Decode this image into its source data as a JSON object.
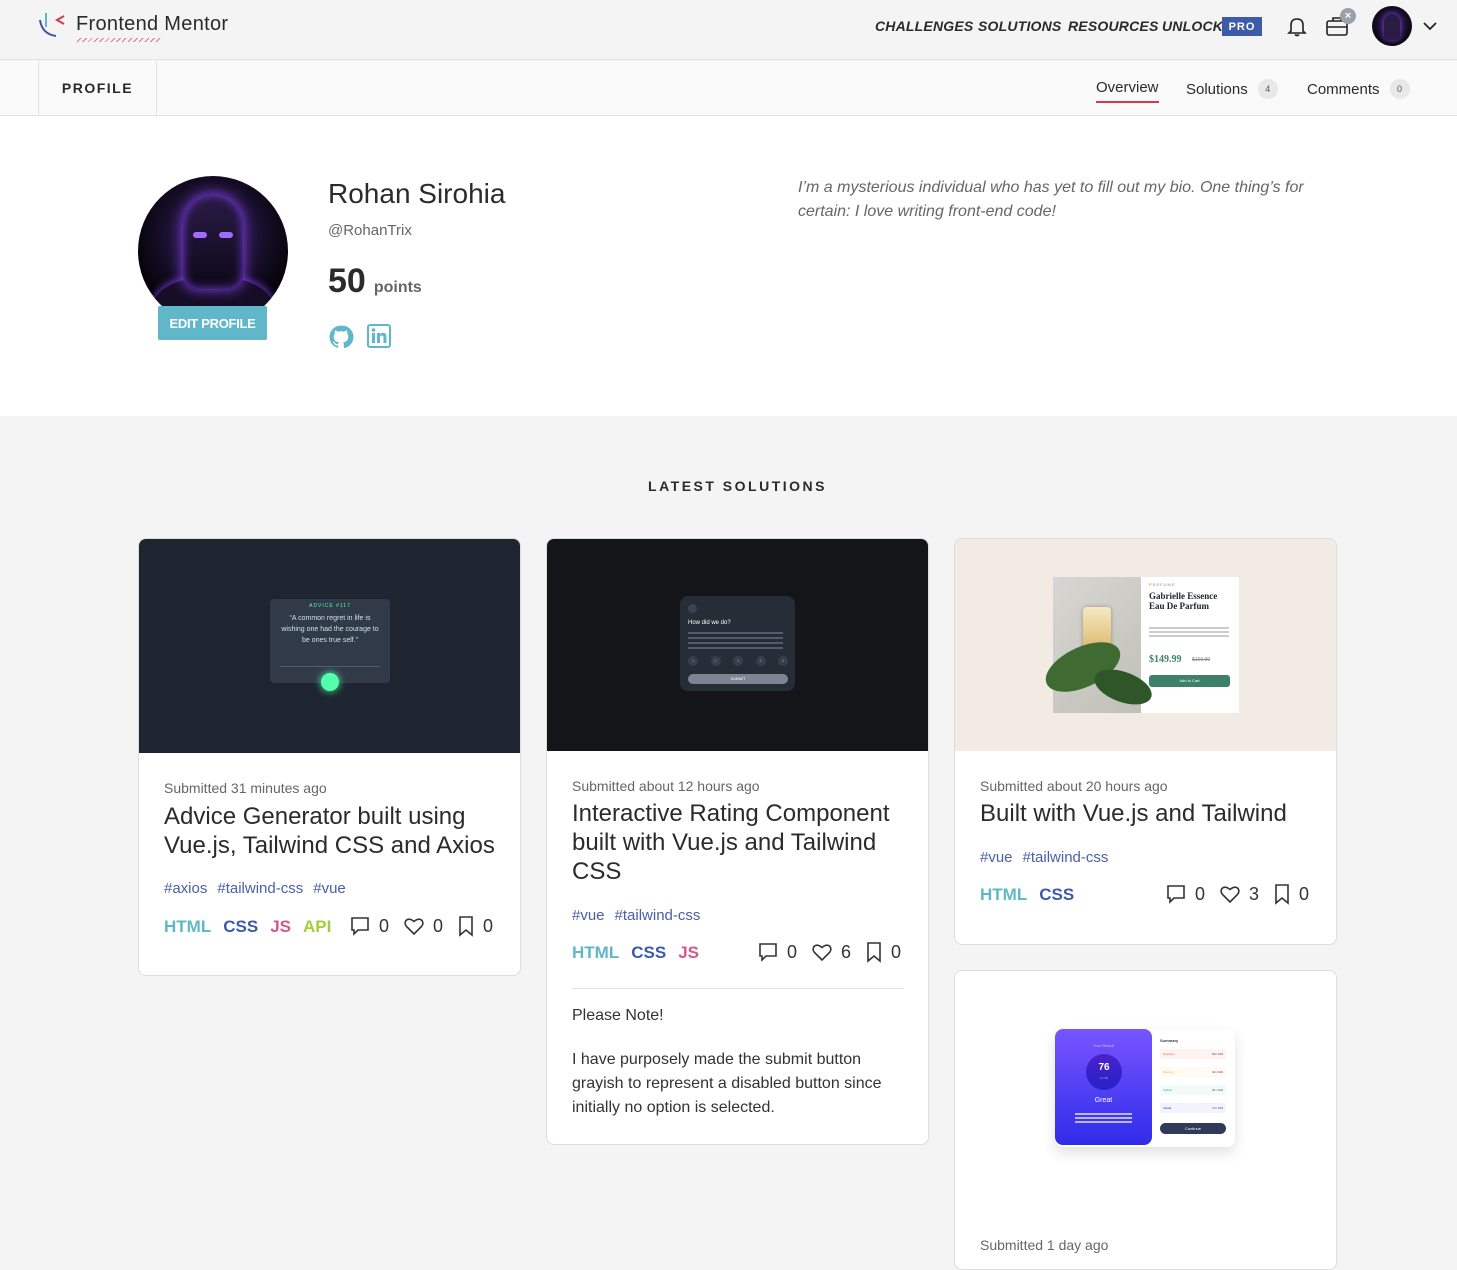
{
  "header": {
    "logo_text": "Frontend Mentor",
    "nav": [
      "CHALLENGES",
      "SOLUTIONS",
      "RESOURCES",
      "UNLOCK"
    ],
    "pro_badge": "PRO",
    "notifications_icon": "bell-icon",
    "toolbox_icon": "briefcase-icon",
    "close_badge": "×",
    "user_menu_icon": "chevron-down-icon"
  },
  "subnav": {
    "section": "PROFILE",
    "tabs": [
      {
        "label": "Overview",
        "count": ""
      },
      {
        "label": "Solutions",
        "count": "4"
      },
      {
        "label": "Comments",
        "count": "0"
      }
    ]
  },
  "profile": {
    "name": "Rohan Sirohia",
    "handle": "@RohanTrix",
    "points_value": "50",
    "points_label": "points",
    "edit_button": "EDIT PROFILE",
    "bio": "I’m a mysterious individual who has yet to fill out my bio. One thing’s for certain: I love writing front-end code!",
    "social_icons": [
      "github-icon",
      "linkedin-icon"
    ]
  },
  "latest": {
    "title": "LATEST SOLUTIONS",
    "cards": [
      {
        "submitted": "Submitted 31 minutes ago",
        "title": "Advice Generator built using Vue.js, Tailwind CSS and Axios",
        "tags": [
          "#axios",
          "#tailwind-css",
          "#vue"
        ],
        "langs": [
          "HTML",
          "CSS",
          "JS",
          "API"
        ],
        "comments": "0",
        "likes": "0",
        "bookmarks": "0",
        "thumb": {
          "label": "ADVICE #117",
          "quote": "“A common regret in life is wishing one had the courage to be ones true self.”"
        }
      },
      {
        "submitted": "Submitted about 12 hours ago",
        "title": "Interactive Rating Component built with Vue.js and Tailwind CSS",
        "tags": [
          "#vue",
          "#tailwind-css"
        ],
        "langs": [
          "HTML",
          "CSS",
          "JS"
        ],
        "comments": "0",
        "likes": "6",
        "bookmarks": "0",
        "note_title": "Please Note!",
        "note_body": "I have purposely made the submit button grayish to represent a disabled button since initially no option is selected.",
        "thumb": {
          "heading": "How did we do?",
          "button": "SUBMIT",
          "ratings": [
            "1",
            "2",
            "3",
            "4",
            "5"
          ]
        }
      },
      {
        "submitted": "Submitted about 20 hours ago",
        "title": "Built with Vue.js and Tailwind",
        "tags": [
          "#vue",
          "#tailwind-css"
        ],
        "langs": [
          "HTML",
          "CSS"
        ],
        "comments": "0",
        "likes": "3",
        "bookmarks": "0",
        "thumb": {
          "category": "PERFUME",
          "product": "Gabrielle Essence Eau De Parfum",
          "price": "$149.99",
          "old_price": "$169.99",
          "button": "Add to Cart"
        }
      },
      {
        "submitted": "Submitted 1 day ago",
        "thumb": {
          "heading": "Your Result",
          "score": "76",
          "of": "of 100",
          "grade": "Great",
          "summary": "Summary",
          "button": "Continue",
          "rows": [
            {
              "name": "Reaction",
              "score": "80 / 100"
            },
            {
              "name": "Memory",
              "score": "92 / 100"
            },
            {
              "name": "Verbal",
              "score": "61 / 100"
            },
            {
              "name": "Visual",
              "score": "72 / 100"
            }
          ]
        }
      }
    ]
  },
  "colors": {
    "accent_red": "#d6384b",
    "teal": "#5fb7c9",
    "html": "#5fb7c9",
    "css": "#3d5ba9",
    "js": "#d5578a",
    "api": "#a6cc3a",
    "tag_blue": "#4a60a8"
  }
}
